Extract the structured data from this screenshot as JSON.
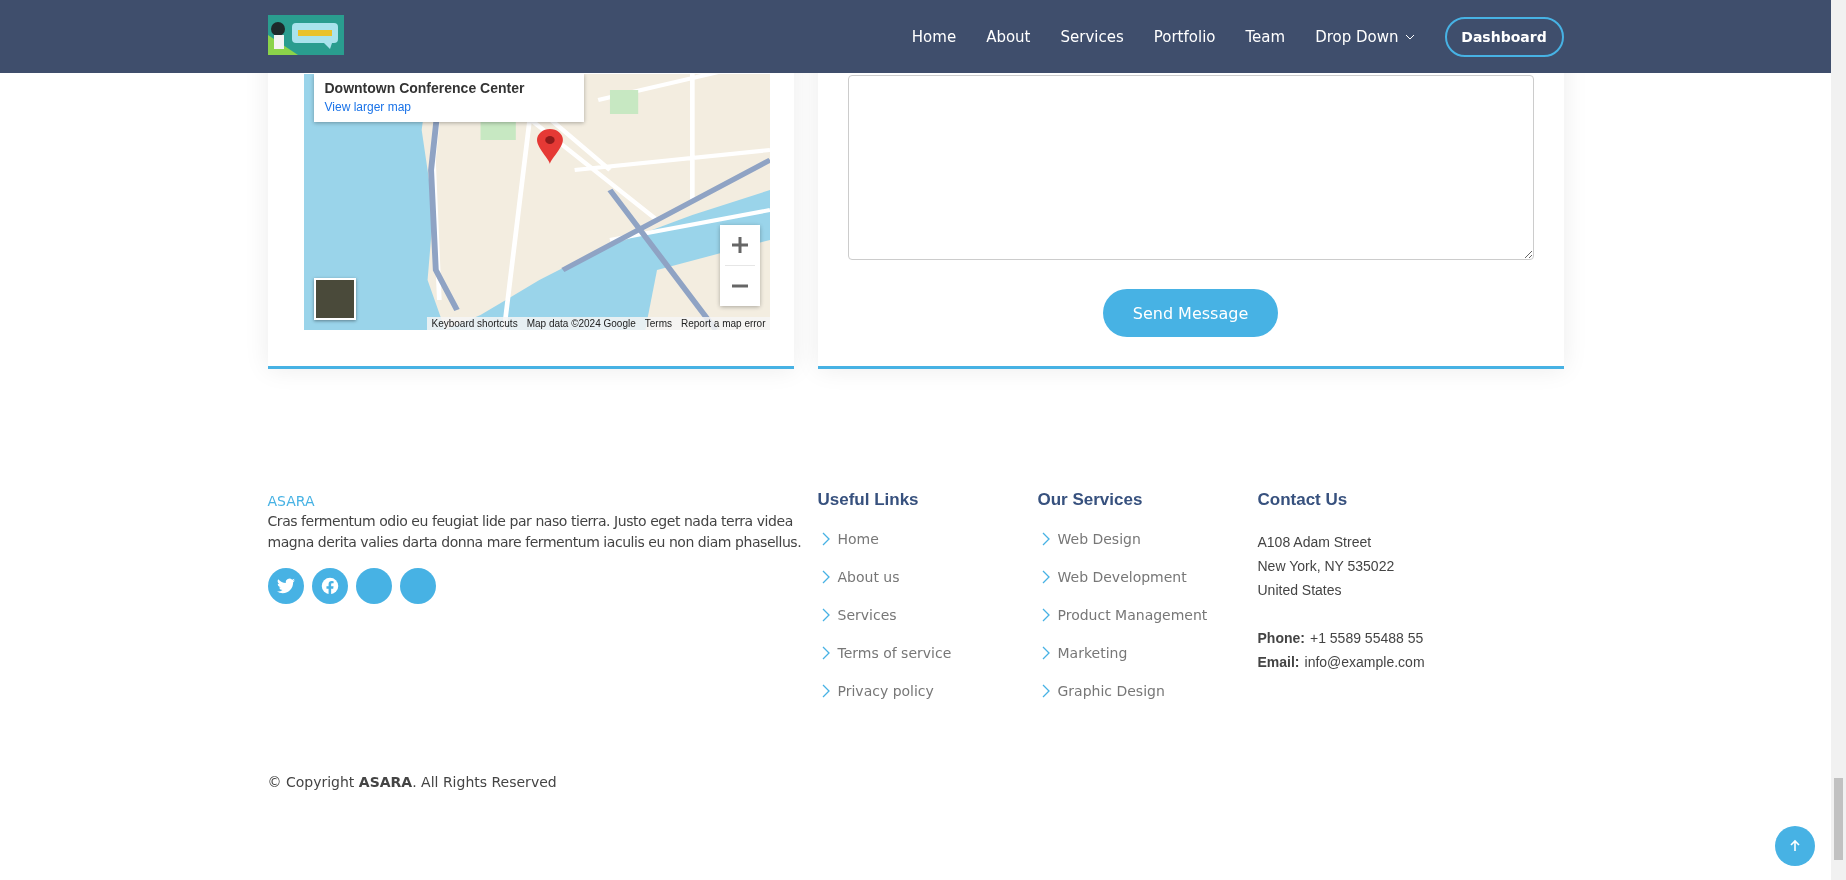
{
  "header": {
    "nav": [
      {
        "label": "Home",
        "kind": "link"
      },
      {
        "label": "About",
        "kind": "link"
      },
      {
        "label": "Services",
        "kind": "link"
      },
      {
        "label": "Portfolio",
        "kind": "link"
      },
      {
        "label": "Team",
        "kind": "link"
      },
      {
        "label": "Drop Down",
        "kind": "dropdown"
      }
    ],
    "cta": "Dashboard"
  },
  "map": {
    "place_title": "Downtown Conference Center",
    "view_larger": "View larger map",
    "attribution": [
      "Keyboard shortcuts",
      "Map data ©2024 Google",
      "Terms",
      "Report a map error"
    ]
  },
  "form": {
    "submit": "Send Message"
  },
  "footer": {
    "brand": "ASARA",
    "about": "Cras fermentum odio eu feugiat lide par naso tierra. Justo eget nada terra videa magna derita valies darta donna mare fermentum iaculis eu non diam phasellus.",
    "social": [
      {
        "kind": "twitter"
      },
      {
        "kind": "facebook"
      },
      {
        "kind": "blank"
      },
      {
        "kind": "blank"
      }
    ],
    "useful_links": {
      "title": "Useful Links",
      "items": [
        "Home",
        "About us",
        "Services",
        "Terms of service",
        "Privacy policy"
      ]
    },
    "services": {
      "title": "Our Services",
      "items": [
        "Web Design",
        "Web Development",
        "Product Management",
        "Marketing",
        "Graphic Design"
      ]
    },
    "contact": {
      "title": "Contact Us",
      "address": [
        "A108 Adam Street",
        "New York, NY 535022",
        "United States"
      ],
      "phone_label": "Phone:",
      "phone": "+1 5589 55488 55",
      "email_label": "Email:",
      "email": "info@example.com"
    },
    "copyright": "© Copyright **ASARA**. All Rights Reserved"
  }
}
